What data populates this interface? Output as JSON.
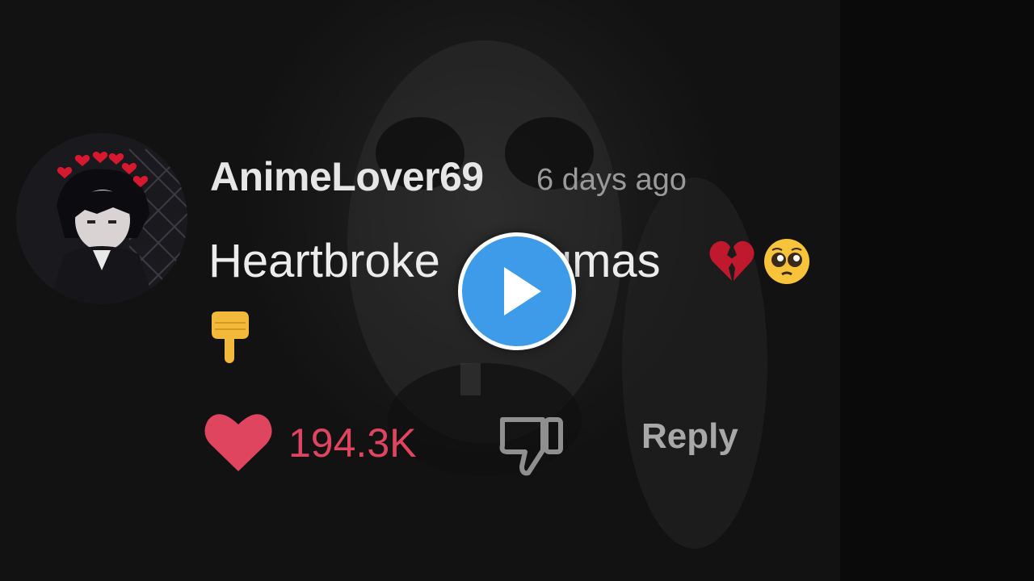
{
  "comment": {
    "username": "AnimeLover69",
    "timestamp": "6 days ago",
    "text": "Heartbroke",
    "text_tail": "igmas",
    "emojis": [
      "broken-heart-emoji",
      "pleading-face-emoji",
      "backhand-index-pointing-down-emoji"
    ],
    "avatar": "anime-avatar"
  },
  "actions": {
    "like_count": "194.3K",
    "like_icon": "heart-icon",
    "dislike_icon": "thumbs-down-icon",
    "reply_label": "Reply"
  },
  "player": {
    "play_icon": "play-icon"
  },
  "colors": {
    "like": "#e04560",
    "play": "#3d9be9",
    "username": "#e6e6e6",
    "muted": "#9a9a9a"
  }
}
